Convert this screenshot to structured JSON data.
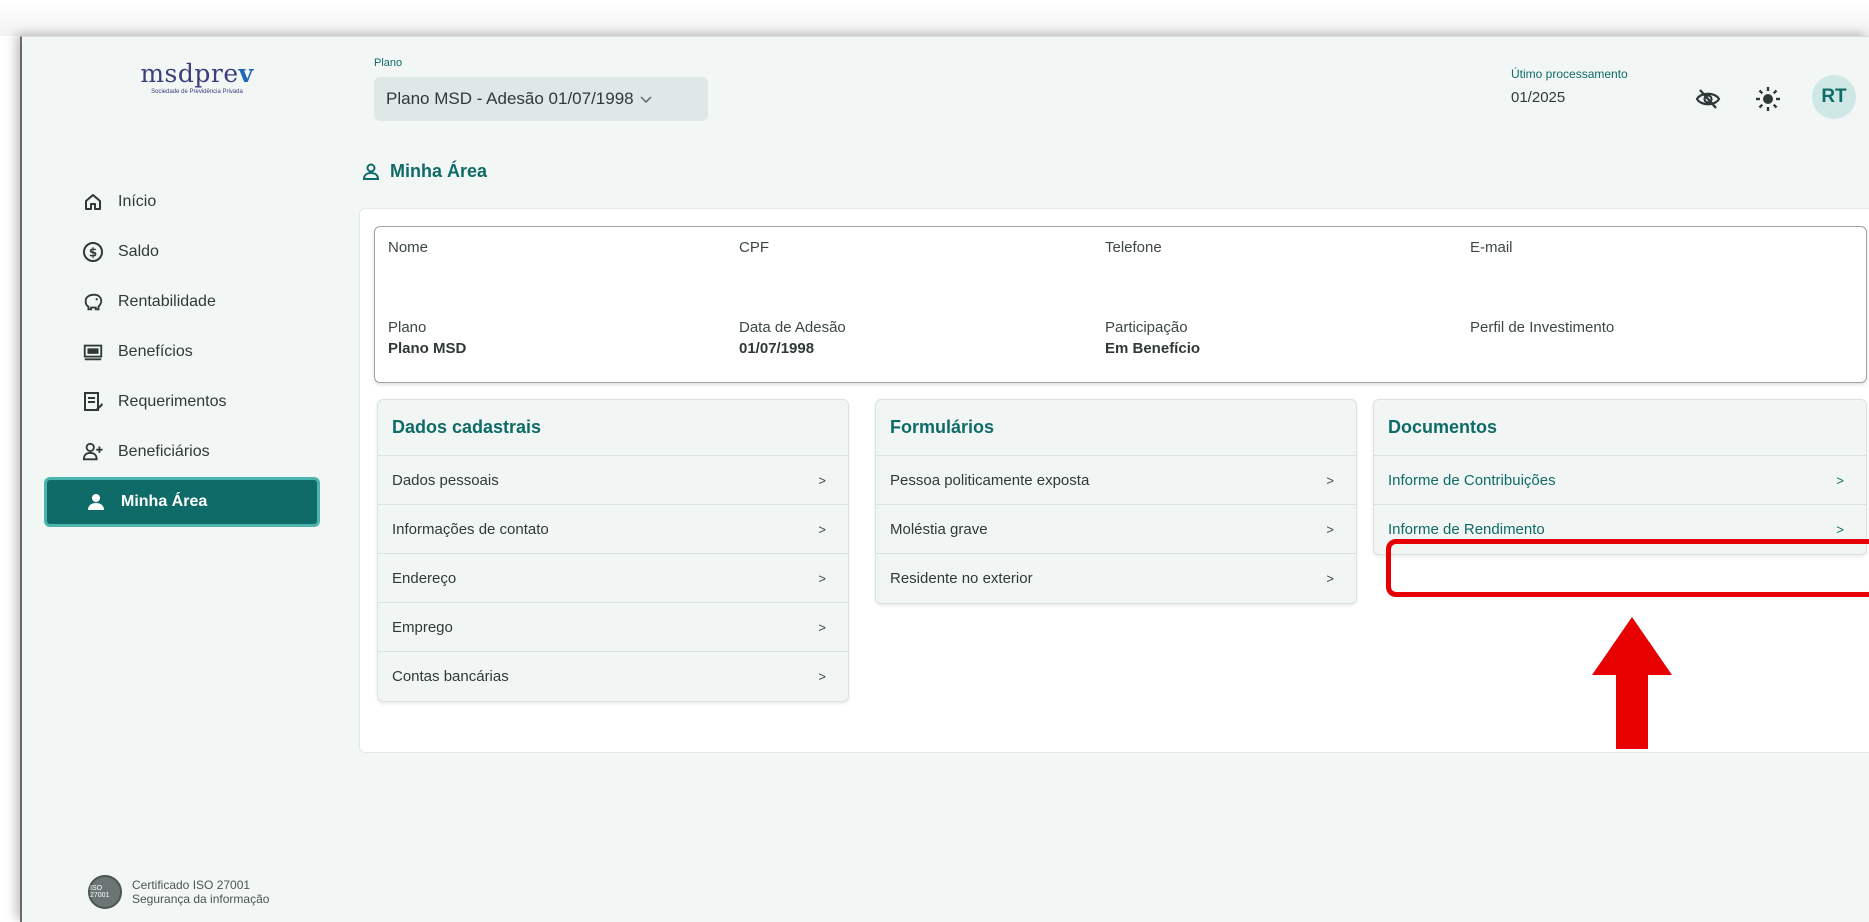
{
  "logo": {
    "name": "msdpre",
    "accent": "v",
    "subtitle": "Sociedade de Previdência Privada"
  },
  "sidebar": {
    "items": [
      {
        "label": "Início",
        "icon": "home-icon"
      },
      {
        "label": "Saldo",
        "icon": "dollar-circle-icon"
      },
      {
        "label": "Rentabilidade",
        "icon": "piggy-bank-icon"
      },
      {
        "label": "Benefícios",
        "icon": "money-screen-icon"
      },
      {
        "label": "Requerimentos",
        "icon": "form-edit-icon"
      },
      {
        "label": "Beneficiários",
        "icon": "user-plus-icon"
      },
      {
        "label": "Minha Área",
        "icon": "user-icon",
        "active": true
      }
    ],
    "iso": {
      "line1": "Certificado ISO 27001",
      "line2": "Segurança da informação",
      "badge": "ISO 27001"
    }
  },
  "header": {
    "plan_label": "Plano",
    "plan_value": "Plano MSD - Adesão 01/07/1998",
    "processing_label": "Útimo processamento",
    "processing_value": "01/2025",
    "avatar_initials": "RT"
  },
  "page_title": "Minha Área",
  "info": {
    "nome_label": "Nome",
    "cpf_label": "CPF",
    "telefone_label": "Telefone",
    "email_label": "E-mail",
    "plano_label": "Plano",
    "plano_value": "Plano MSD",
    "adesao_label": "Data de Adesão",
    "adesao_value": "01/07/1998",
    "participacao_label": "Participação",
    "participacao_value": "Em Benefício",
    "perfil_label": "Perfil de Investimento"
  },
  "panels": {
    "cadastrais": {
      "title": "Dados cadastrais",
      "rows": [
        "Dados pessoais",
        "Informações de contato",
        "Endereço",
        "Emprego",
        "Contas bancárias"
      ]
    },
    "formularios": {
      "title": "Formulários",
      "rows": [
        "Pessoa politicamente exposta",
        "Moléstia grave",
        "Residente no exterior"
      ]
    },
    "documentos": {
      "title": "Documentos",
      "rows": [
        "Informe de Contribuições",
        "Informe de Rendimento"
      ]
    }
  },
  "row_arrow": ">",
  "colors": {
    "primary": "#0f6b67",
    "highlight": "#e60000",
    "background": "#f2f7f6"
  }
}
